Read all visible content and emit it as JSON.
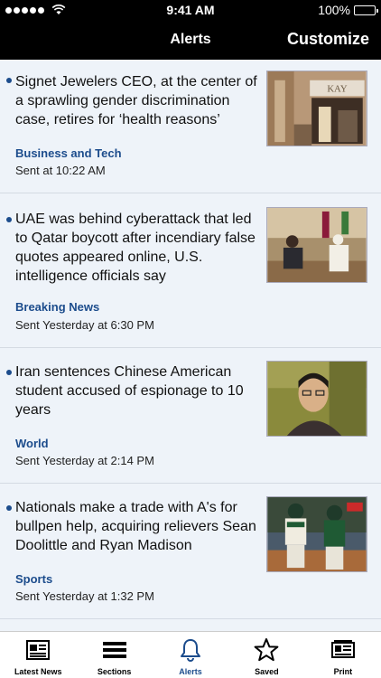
{
  "status": {
    "time": "9:41 AM",
    "battery": "100%",
    "battery_level": 1.0
  },
  "nav": {
    "title": "Alerts",
    "action": "Customize"
  },
  "alerts": [
    {
      "headline": "Signet Jewelers CEO, at the center of a sprawling gender discrimination case, retires for ‘health reasons’",
      "category": "Business and Tech",
      "sent": "Sent at 10:22 AM",
      "thumb_sign": "KAY"
    },
    {
      "headline": "UAE was behind cyberattack that led to Qatar boycott after incendiary false quotes appeared online, U.S. intelligence officials say",
      "category": "Breaking News",
      "sent": "Sent Yesterday at 6:30 PM"
    },
    {
      "headline": "Iran sentences Chinese American student accused of espionage to 10 years",
      "category": "World",
      "sent": "Sent Yesterday at 2:14 PM"
    },
    {
      "headline": "Nationals make a trade with A's for bullpen help, acquiring relievers Sean Doolittle and Ryan Madison",
      "category": "Sports",
      "sent": "Sent Yesterday at 1:32 PM"
    }
  ],
  "tabs": [
    {
      "label": "Latest News",
      "icon": "newspaper-icon"
    },
    {
      "label": "Sections",
      "icon": "menu-icon"
    },
    {
      "label": "Alerts",
      "icon": "bell-icon",
      "active": true
    },
    {
      "label": "Saved",
      "icon": "star-icon"
    },
    {
      "label": "Print",
      "icon": "print-icon"
    }
  ],
  "colors": {
    "accent": "#1c4c8c",
    "bar": "#000000",
    "background": "#eef3f9"
  }
}
